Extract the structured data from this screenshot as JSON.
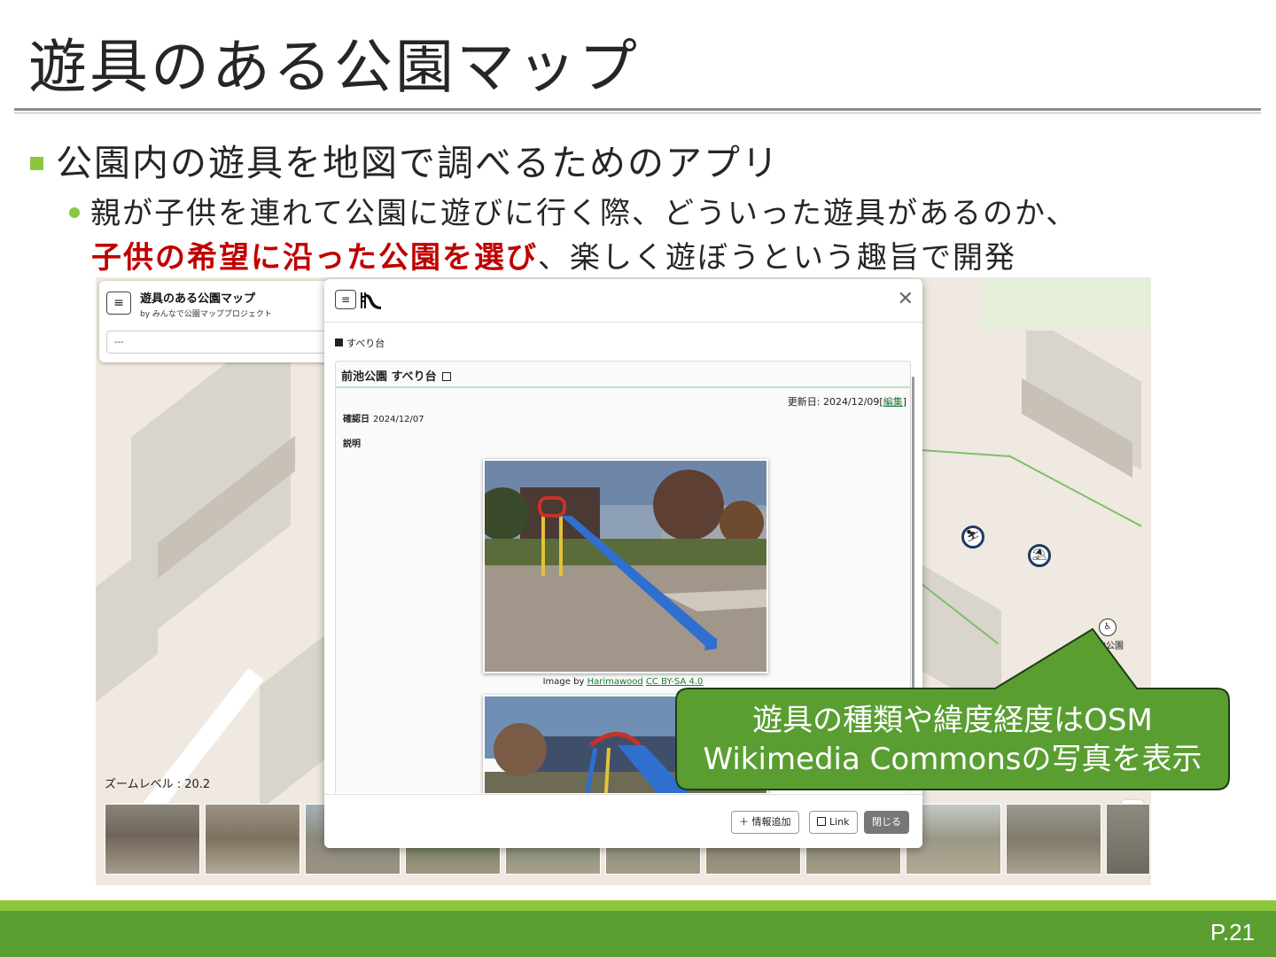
{
  "slide": {
    "title": "遊具のある公園マップ",
    "bullet1": "公園内の遊具を地図で調べるためのアプリ",
    "bullet2_line1": "親が子供を連れて公園に遊びに行く際、どういった遊具があるのか、",
    "bullet2_emph": "子供の希望に沿った公園を選び",
    "bullet2_rest": "、楽しく遊ぼうという趣旨で開発",
    "page_number": "P.21"
  },
  "app": {
    "title": "遊具のある公園マップ",
    "subtitle": "by みんなで公園マッププロジェクト",
    "select_value": "---",
    "zoom_level": "ズームレベル : 20.2",
    "park_label": "前池公園"
  },
  "modal": {
    "category": "すべり台",
    "card_title": "前池公園 すべり台",
    "updated_prefix": "更新日: 2024/12/09[",
    "edit_link": "編集",
    "updated_suffix": "]",
    "confirmed_label": "確認日",
    "confirmed_value": "2024/12/07",
    "description_label": "説明",
    "credit_prefix": "Image by ",
    "credit_author": "Harimawood",
    "credit_license": "CC BY-SA 4.0",
    "buttons": {
      "add_info": "情報追加",
      "link": "Link",
      "close": "閉じる"
    }
  },
  "callout": {
    "line1": "遊具の種類や緯度経度はOSM",
    "line2": "Wikimedia Commonsの写真を表示"
  },
  "colors": {
    "accent_green": "#8cc63f",
    "footer_green": "#5a9e32",
    "emphasis_red": "#c00000",
    "callout_fill": "#5a9e32",
    "slide_color": "#2f7fd6",
    "link_green": "#1a7a33"
  }
}
